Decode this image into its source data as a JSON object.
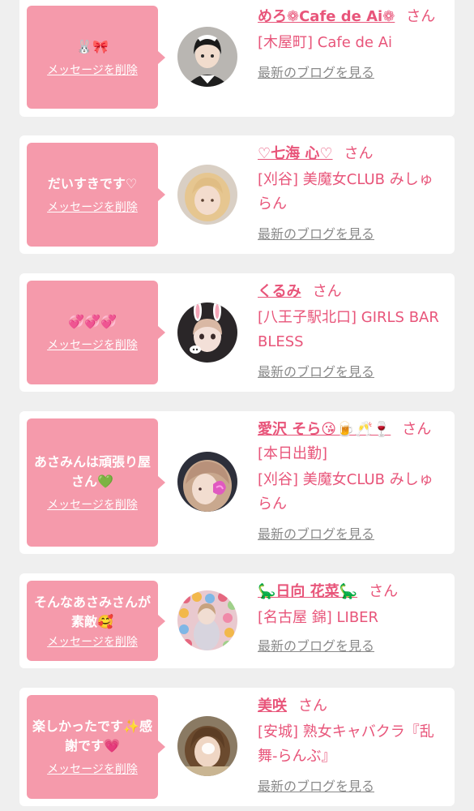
{
  "delete_label": "メッセージを削除",
  "blog_label": "最新のブログを見る",
  "san": "さん",
  "cards": [
    {
      "message": "🐰🎀",
      "name": "めろ❁Cafe de Ai❁",
      "name_extra": "",
      "shop": "[木屋町] Cafe de Ai"
    },
    {
      "message": "だいすきです♡",
      "name": "♡七海 心♡",
      "name_extra": "",
      "shop": "[刈谷] 美魔女CLUB みしゅらん"
    },
    {
      "message": "💞💞💞",
      "name": "くるみ",
      "name_extra": "",
      "shop": "[八王子駅北口] GIRLS BAR BLESS"
    },
    {
      "message": "あさみんは頑張り屋さん💚",
      "name": "愛沢 そら😘🍺🥂🍷",
      "name_extra": "[本日出勤]",
      "shop": "[刈谷] 美魔女CLUB みしゅらん"
    },
    {
      "message": "そんなあさみさんが素敵🥰",
      "name": "🦕日向 花菜🦕",
      "name_extra": "",
      "shop": "[名古屋 錦] LIBER"
    },
    {
      "message": "楽しかったです✨感謝です💗",
      "name": "美咲",
      "name_extra": "",
      "shop": "[安城] 熟女キャバクラ『乱舞-らんぶ』"
    }
  ]
}
